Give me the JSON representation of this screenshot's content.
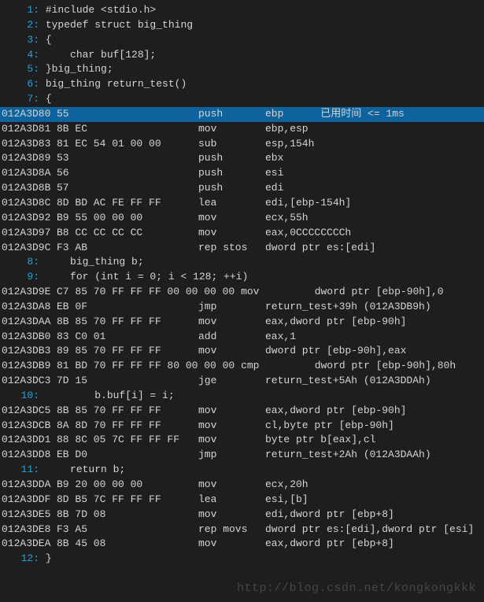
{
  "source": {
    "l1": "#include <stdio.h>",
    "l2": "typedef struct big_thing",
    "l3": "{",
    "l4": "    char buf[128];",
    "l5": "}big_thing;",
    "l6": "big_thing return_test()",
    "l7": "{",
    "l8": "    big_thing b;",
    "l9": "    for (int i = 0; i < 128; ++i)",
    "l10": "        b.buf[i] = i;",
    "l11": "    return b;",
    "l12": "}",
    "ln1": "1:",
    "ln2": "2:",
    "ln3": "3:",
    "ln4": "4:",
    "ln5": "5:",
    "ln6": "6:",
    "ln7": "7:",
    "ln8": "8:",
    "ln9": "9:",
    "ln10": "10:",
    "ln11": "11:",
    "ln12": "12:"
  },
  "asm": {
    "r1_addr": "012A3D80",
    "r1_b": "55",
    "r1_m": "push",
    "r1_o": "ebp",
    "r1_note": "      已用时间 <= 1ms",
    "r2_addr": "012A3D81",
    "r2_b": "8B EC",
    "r2_m": "mov",
    "r2_o": "ebp,esp",
    "r3_addr": "012A3D83",
    "r3_b": "81 EC 54 01 00 00",
    "r3_m": "sub",
    "r3_o": "esp,154h",
    "r4_addr": "012A3D89",
    "r4_b": "53",
    "r4_m": "push",
    "r4_o": "ebx",
    "r5_addr": "012A3D8A",
    "r5_b": "56",
    "r5_m": "push",
    "r5_o": "esi",
    "r6_addr": "012A3D8B",
    "r6_b": "57",
    "r6_m": "push",
    "r6_o": "edi",
    "r7_addr": "012A3D8C",
    "r7_b": "8D BD AC FE FF FF",
    "r7_m": "lea",
    "r7_o": "edi,[ebp-154h]",
    "r8_addr": "012A3D92",
    "r8_b": "B9 55 00 00 00",
    "r8_m": "mov",
    "r8_o": "ecx,55h",
    "r9_addr": "012A3D97",
    "r9_b": "B8 CC CC CC CC",
    "r9_m": "mov",
    "r9_o": "eax,0CCCCCCCCh",
    "r10_addr": "012A3D9C",
    "r10_b": "F3 AB",
    "r10_m": "rep stos",
    "r10_o": "dword ptr es:[edi]",
    "r11_addr": "012A3D9E",
    "r11_b": "C7 85 70 FF FF FF 00 00 00 00",
    "r11_m": "mov",
    "r11_o": "dword ptr [ebp-90h],0",
    "r12_addr": "012A3DA8",
    "r12_b": "EB 0F",
    "r12_m": "jmp",
    "r12_o": "return_test+39h (012A3DB9h)",
    "r13_addr": "012A3DAA",
    "r13_b": "8B 85 70 FF FF FF",
    "r13_m": "mov",
    "r13_o": "eax,dword ptr [ebp-90h]",
    "r14_addr": "012A3DB0",
    "r14_b": "83 C0 01",
    "r14_m": "add",
    "r14_o": "eax,1",
    "r15_addr": "012A3DB3",
    "r15_b": "89 85 70 FF FF FF",
    "r15_m": "mov",
    "r15_o": "dword ptr [ebp-90h],eax",
    "r16_addr": "012A3DB9",
    "r16_b": "81 BD 70 FF FF FF 80 00 00 00",
    "r16_m": "cmp",
    "r16_o": "dword ptr [ebp-90h],80h",
    "r17_addr": "012A3DC3",
    "r17_b": "7D 15",
    "r17_m": "jge",
    "r17_o": "return_test+5Ah (012A3DDAh)",
    "r18_addr": "012A3DC5",
    "r18_b": "8B 85 70 FF FF FF",
    "r18_m": "mov",
    "r18_o": "eax,dword ptr [ebp-90h]",
    "r19_addr": "012A3DCB",
    "r19_b": "8A 8D 70 FF FF FF",
    "r19_m": "mov",
    "r19_o": "cl,byte ptr [ebp-90h]",
    "r20_addr": "012A3DD1",
    "r20_b": "88 8C 05 7C FF FF FF",
    "r20_m": "mov",
    "r20_o": "byte ptr b[eax],cl",
    "r21_addr": "012A3DD8",
    "r21_b": "EB D0",
    "r21_m": "jmp",
    "r21_o": "return_test+2Ah (012A3DAAh)",
    "r22_addr": "012A3DDA",
    "r22_b": "B9 20 00 00 00",
    "r22_m": "mov",
    "r22_o": "ecx,20h",
    "r23_addr": "012A3DDF",
    "r23_b": "8D B5 7C FF FF FF",
    "r23_m": "lea",
    "r23_o": "esi,[b]",
    "r24_addr": "012A3DE5",
    "r24_b": "8B 7D 08",
    "r24_m": "mov",
    "r24_o": "edi,dword ptr [ebp+8]",
    "r25_addr": "012A3DE8",
    "r25_b": "F3 A5",
    "r25_m": "rep movs",
    "r25_o": "dword ptr es:[edi],dword ptr [esi]",
    "r26_addr": "012A3DEA",
    "r26_b": "8B 45 08",
    "r26_m": "mov",
    "r26_o": "eax,dword ptr [ebp+8]"
  },
  "watermark": "http://blog.csdn.net/kongkongkkk"
}
